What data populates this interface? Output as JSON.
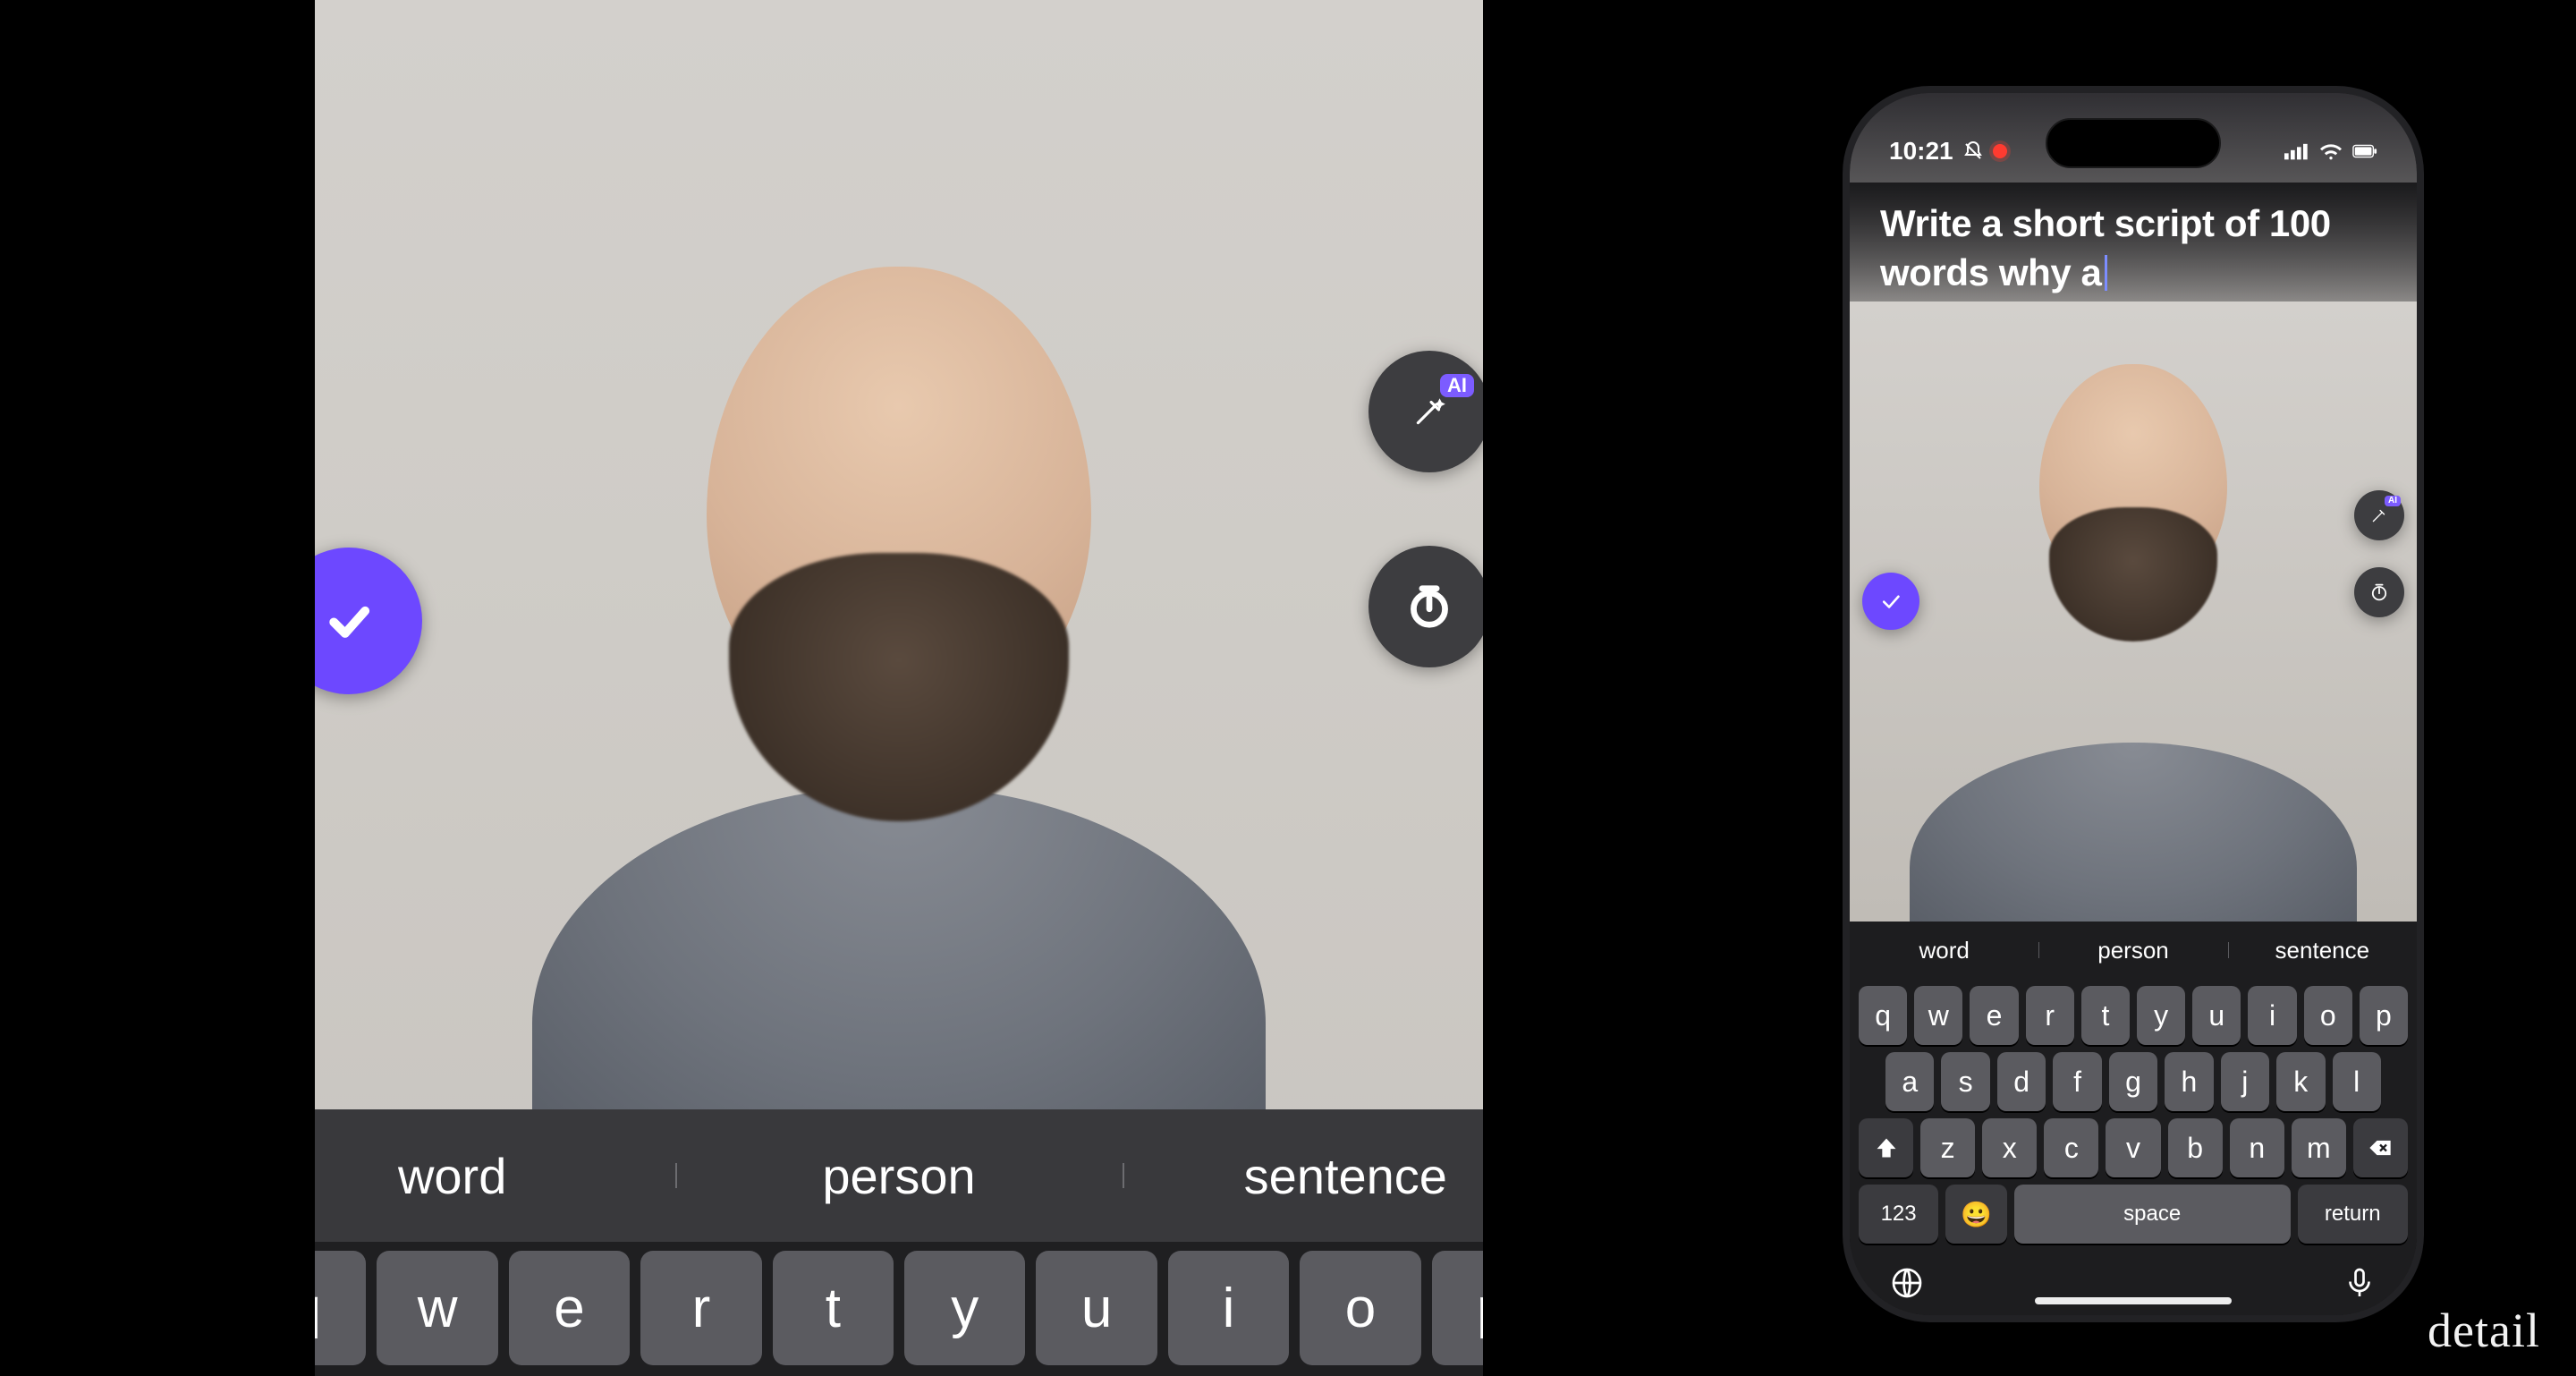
{
  "colors": {
    "accent": "#6d48ff",
    "ai_badge": "#7c5cff",
    "key_bg": "#5b5b60",
    "fn_key_bg": "#3b3b3f"
  },
  "main": {
    "suggestions": [
      "word",
      "person",
      "sentence"
    ],
    "keyboard_row": [
      "q",
      "w",
      "e",
      "r",
      "t",
      "y",
      "u",
      "i",
      "o",
      "p"
    ],
    "ai_badge_label": "AI"
  },
  "phone": {
    "status": {
      "time": "10:21"
    },
    "prompt_text": "Write a short script of 100 words why a",
    "ai_badge_label": "AI",
    "suggestions": [
      "word",
      "person",
      "sentence"
    ],
    "keyboard": {
      "row1": [
        "q",
        "w",
        "e",
        "r",
        "t",
        "y",
        "u",
        "i",
        "o",
        "p"
      ],
      "row2": [
        "a",
        "s",
        "d",
        "f",
        "g",
        "h",
        "j",
        "k",
        "l"
      ],
      "row3": [
        "z",
        "x",
        "c",
        "v",
        "b",
        "n",
        "m"
      ],
      "num_key": "123",
      "space_label": "space",
      "return_label": "return"
    }
  },
  "watermark": "detail"
}
